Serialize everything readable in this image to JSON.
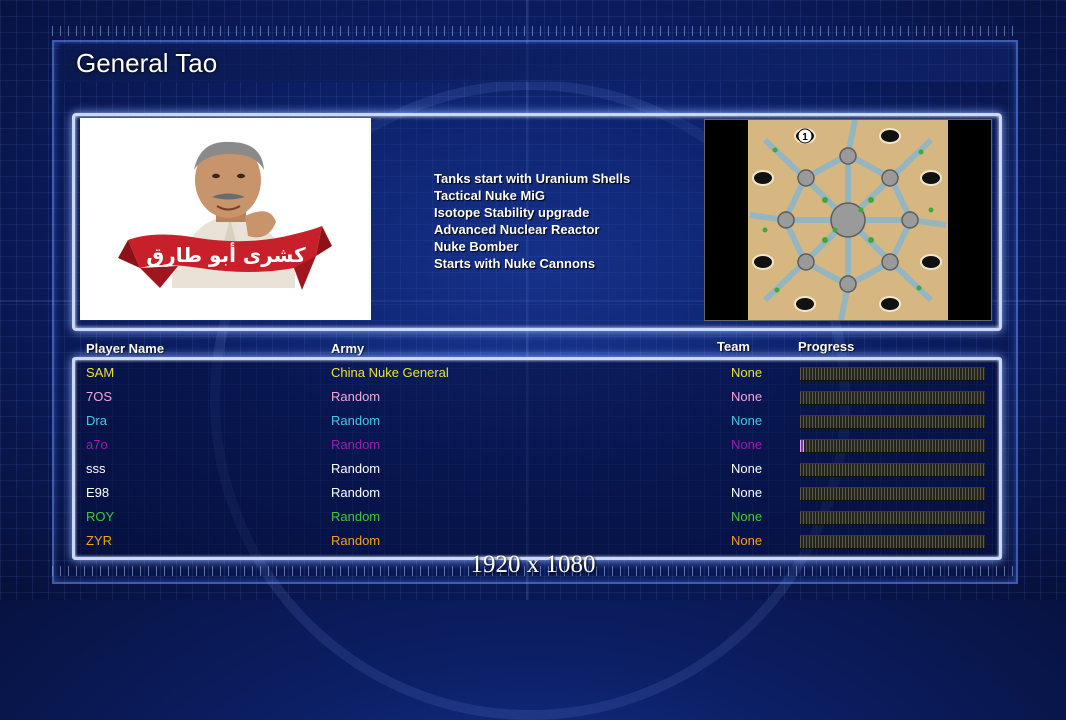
{
  "general": {
    "title": "General Tao"
  },
  "portrait": {
    "banner_text": "كشرى أبو طارق",
    "banner_color": "#c8202a"
  },
  "features": [
    "Tanks start with Uranium Shells",
    "Tactical Nuke MiG",
    "Isotope Stability upgrade",
    "Advanced Nuclear Reactor",
    "Nuke Bomber",
    "Starts with Nuke Cannons"
  ],
  "map": {
    "start_marker": "1"
  },
  "columns": {
    "name": "Player Name",
    "army": "Army",
    "team": "Team",
    "progress": "Progress"
  },
  "players": [
    {
      "name": "SAM",
      "army": "China Nuke General",
      "team": "None",
      "color": "#e8e23a",
      "progress": 0
    },
    {
      "name": "7OS",
      "army": "Random",
      "team": "None",
      "color": "#f7a6d6",
      "progress": 0
    },
    {
      "name": "Dra",
      "army": "Random",
      "team": "None",
      "color": "#45c8e6",
      "progress": 0
    },
    {
      "name": "a7o",
      "army": "Random",
      "team": "None",
      "color": "#9a1fae",
      "progress": 0.02
    },
    {
      "name": "sss",
      "army": "Random",
      "team": "None",
      "color": "#ffffff",
      "progress": 0
    },
    {
      "name": "E98",
      "army": "Random",
      "team": "None",
      "color": "#ffffff",
      "progress": 0
    },
    {
      "name": "ROY",
      "army": "Random",
      "team": "None",
      "color": "#3fc83f",
      "progress": 0
    },
    {
      "name": "ZYR",
      "army": "Random",
      "team": "None",
      "color": "#f0a020",
      "progress": 0
    }
  ],
  "resolution": "1920 x 1080"
}
